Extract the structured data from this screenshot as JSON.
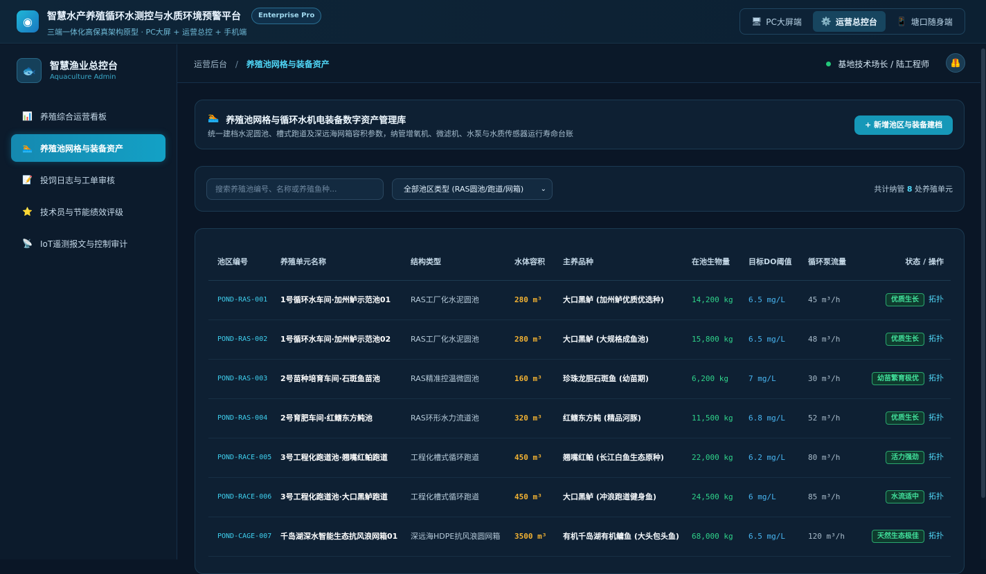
{
  "header": {
    "title": "智慧水产养殖循环水测控与水质环境预警平台",
    "subtitle": "三端一体化高保真架构原型 · PC大屏 + 运营总控 + 手机端",
    "edition": "Enterprise Pro",
    "logo_icon": "fish-icon",
    "switcher": [
      {
        "label": "PC大屏端",
        "icon": "🖥"
      },
      {
        "label": "运营总控台",
        "icon": "⚙️"
      },
      {
        "label": "塘口随身端",
        "icon": "📱"
      }
    ]
  },
  "sidebar": {
    "title": "智慧渔业总控台",
    "subtitle": "Aquaculture Admin",
    "logo_icon": "🐟",
    "items": [
      {
        "label": "养殖综合运营看板",
        "icon": "📊"
      },
      {
        "label": "养殖池网格与装备资产",
        "icon": "🏊"
      },
      {
        "label": "投饲日志与工单审核",
        "icon": "📝"
      },
      {
        "label": "技术员与节能绩效评级",
        "icon": "⭐"
      },
      {
        "label": "IoT遥测报文与控制审计",
        "icon": "📡"
      }
    ]
  },
  "breadcrumb": {
    "root": "运营后台",
    "separator": "/",
    "current": "养殖池网格与装备资产"
  },
  "user": {
    "name": "基地技术场长 / 陆工程师",
    "avatar": "🦺",
    "status_color": "#23c77a"
  },
  "hero": {
    "icon": "🏊",
    "title": "养殖池网格与循环水机电装备数字资产管理库",
    "desc": "统一建档水泥圆池、槽式跑道及深远海网箱容积参数，纳管增氧机、微滤机、水泵与水质传感器运行寿命台账",
    "add_label": "+ 新增池区与装备建档"
  },
  "filter": {
    "search_placeholder": "搜索养殖池编号、名称或养殖鱼种...",
    "select_value": "全部池区类型 (RAS圆池/跑道/网箱)",
    "count_prefix": "共计纳管",
    "count_value": "8",
    "count_suffix": "处养殖单元"
  },
  "table": {
    "headers": [
      "池区编号",
      "养殖单元名称",
      "结构类型",
      "水体容积",
      "主养品种",
      "在池生物量",
      "目标DO阈值",
      "循环泵流量",
      "状态 / 操作"
    ],
    "rows": [
      {
        "id": "POND-RAS-001",
        "name": "1号循环水车间·加州鲈示范池01",
        "structure": "RAS工厂化水泥圆池",
        "volume": "280 m³",
        "species": "大口黑鲈 (加州鲈优质优选种)",
        "biomass": "14,200 kg",
        "do": "6.5 mg/L",
        "flow": "45 m³/h",
        "status": "优质生长",
        "action": "拓扑"
      },
      {
        "id": "POND-RAS-002",
        "name": "1号循环水车间·加州鲈示范池02",
        "structure": "RAS工厂化水泥圆池",
        "volume": "280 m³",
        "species": "大口黑鲈 (大规格成鱼池)",
        "biomass": "15,800 kg",
        "do": "6.5 mg/L",
        "flow": "48 m³/h",
        "status": "优质生长",
        "action": "拓扑"
      },
      {
        "id": "POND-RAS-003",
        "name": "2号苗种培育车间·石斑鱼苗池",
        "structure": "RAS精准控温微圆池",
        "volume": "160 m³",
        "species": "珍珠龙胆石斑鱼 (幼苗期)",
        "biomass": "6,200 kg",
        "do": "7 mg/L",
        "flow": "30 m³/h",
        "status": "幼苗繁育极优",
        "action": "拓扑"
      },
      {
        "id": "POND-RAS-004",
        "name": "2号育肥车间·红鳍东方鲀池",
        "structure": "RAS环形水力流道池",
        "volume": "320 m³",
        "species": "红鳍东方鲀 (精品河豚)",
        "biomass": "11,500 kg",
        "do": "6.8 mg/L",
        "flow": "52 m³/h",
        "status": "优质生长",
        "action": "拓扑"
      },
      {
        "id": "POND-RACE-005",
        "name": "3号工程化跑道池·翘嘴红鲌跑道",
        "structure": "工程化槽式循环跑道",
        "volume": "450 m³",
        "species": "翘嘴红鲌 (长江白鱼生态原种)",
        "biomass": "22,000 kg",
        "do": "6.2 mg/L",
        "flow": "80 m³/h",
        "status": "活力强劲",
        "action": "拓扑"
      },
      {
        "id": "POND-RACE-006",
        "name": "3号工程化跑道池·大口黑鲈跑道",
        "structure": "工程化槽式循环跑道",
        "volume": "450 m³",
        "species": "大口黑鲈 (冲浪跑道健身鱼)",
        "biomass": "24,500 kg",
        "do": "6 mg/L",
        "flow": "85 m³/h",
        "status": "水流适中",
        "action": "拓扑"
      },
      {
        "id": "POND-CAGE-007",
        "name": "千岛湖深水智能生态抗风浪网箱01",
        "structure": "深远海HDPE抗风浪圆网箱",
        "volume": "3500 m³",
        "species": "有机千岛湖有机鳙鱼 (大头包头鱼)",
        "biomass": "68,000 kg",
        "do": "6.5 mg/L",
        "flow": "120 m³/h",
        "status": "天然生态极佳",
        "action": "拓扑"
      }
    ]
  }
}
